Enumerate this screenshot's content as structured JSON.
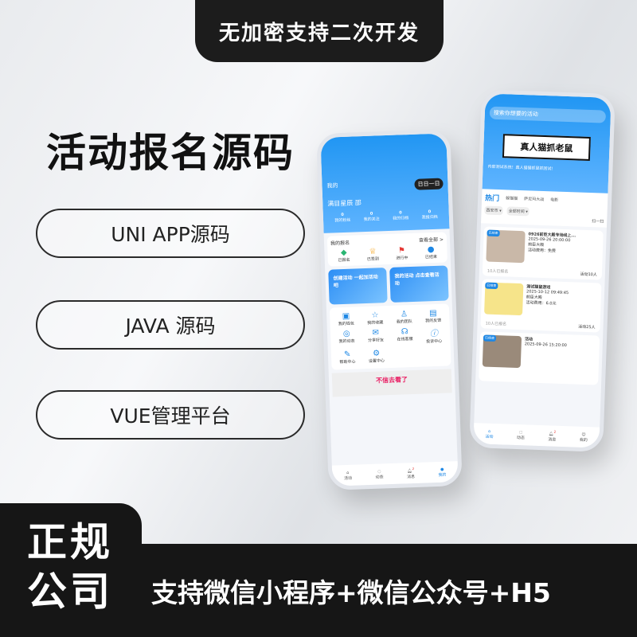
{
  "top_banner": "无加密支持二次开发",
  "title": "活动报名源码",
  "features": [
    "UNI APP源码",
    "JAVA 源码",
    "VUE管理平台"
  ],
  "badge": [
    "正规",
    "公司"
  ],
  "support_text": "支持微信小程序+微信公众号+H5",
  "phone_left": {
    "page_title": "我的",
    "sign_button": "日日一日",
    "username": "满目星辰 邵",
    "stats": [
      {
        "value": "0",
        "label": "我的粉丝"
      },
      {
        "value": "0",
        "label": "我的关注"
      },
      {
        "value": "0",
        "label": "我的归档"
      },
      {
        "value": "0",
        "label": "我报归档"
      }
    ],
    "view_all": "查看全部 >",
    "section": "我的报名",
    "status": [
      "已报名",
      "已签到",
      "进行中",
      "已结束"
    ],
    "banners": [
      "创建活动 一起加活动吧",
      "我的活动 点击查看活动"
    ],
    "menu": [
      "我的钱包",
      "我的收藏",
      "我的团队",
      "我的反馈",
      "我的动态",
      "分享好友",
      "在线客服",
      "投诉中心",
      "帮助中心",
      "设置中心"
    ],
    "ad": "不信去看了",
    "tabs": [
      "活动",
      "动态",
      "消息",
      "我的"
    ],
    "badge_count": "2"
  },
  "phone_right": {
    "search_placeholder": "搜索你想要的活动",
    "poster": "真人猫抓老鼠",
    "notice": "内部测试系统！真人猫猫抓鼠抓回试！",
    "hot": "热门",
    "categories": [
      "躲猫猫",
      "萨尼玛大战",
      "电影"
    ],
    "filters": [
      "西安市 ▾",
      "全部时间 ▾"
    ],
    "scan": "扫一扫",
    "activities": [
      {
        "tag": "已结束",
        "title": "0926前臣大殿专场线上...",
        "time": "2025-09-26 20:00:00",
        "place": "前臣大殿",
        "fee": "活动费用：免费",
        "joined": "10人已报名",
        "limit": "活动10人"
      },
      {
        "tag": "已结束",
        "title": "测试猫鼠游戏",
        "time": "2025-10-12 09:49:45",
        "place": "前臣大殿",
        "fee": "活动费用：6.0元",
        "joined": "10人已报名",
        "limit": "活动25人"
      },
      {
        "tag": "已结束",
        "title": "活动",
        "time": "2025-09-26 15:20:00"
      }
    ],
    "tabs": [
      "活动",
      "动态",
      "消息",
      "我的"
    ],
    "badge_count": "2"
  }
}
